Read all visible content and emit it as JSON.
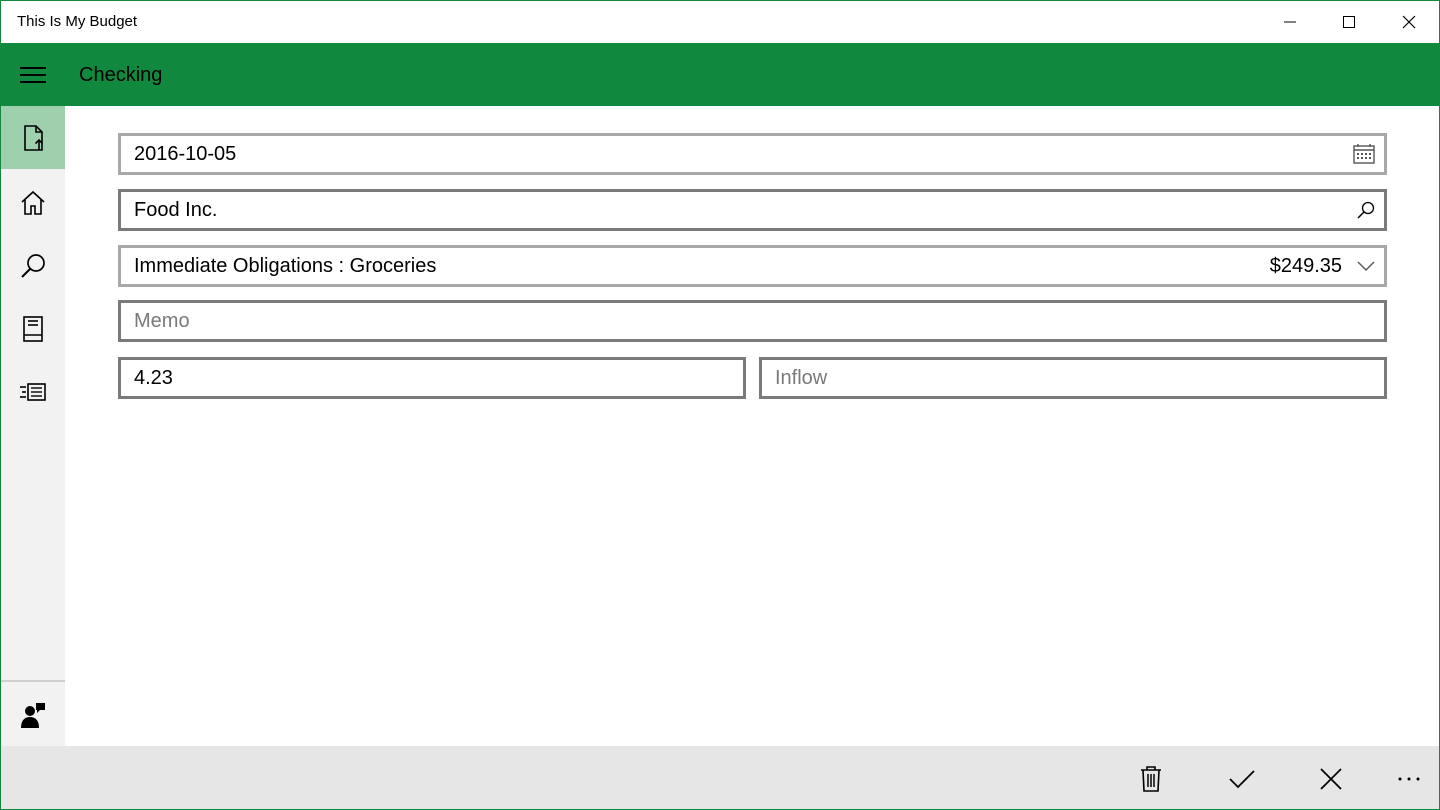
{
  "window": {
    "title": "This Is My Budget",
    "controls": [
      "minimize-icon",
      "maximize-icon",
      "close-icon"
    ]
  },
  "header": {
    "menu_icon": "hamburger-icon",
    "title": "Checking",
    "color": "#10893e"
  },
  "sidebar": {
    "items": [
      {
        "icon": "new-document-icon",
        "active": true
      },
      {
        "icon": "home-icon",
        "active": false
      },
      {
        "icon": "search-icon",
        "active": false
      },
      {
        "icon": "book-icon",
        "active": false
      },
      {
        "icon": "list-icon",
        "active": false
      }
    ],
    "footer_icon": "feedback-icon"
  },
  "form": {
    "date": {
      "value": "2016-10-05",
      "icon": "calendar-icon"
    },
    "payee": {
      "value": "Food Inc.",
      "icon": "search-icon"
    },
    "category": {
      "value": "Immediate Obligations : Groceries",
      "amount": "$249.35",
      "icon": "chevron-down-icon"
    },
    "memo": {
      "value": "",
      "placeholder": "Memo"
    },
    "outflow": {
      "value": "4.23"
    },
    "inflow": {
      "value": "",
      "placeholder": "Inflow"
    }
  },
  "commands": [
    "delete-icon",
    "accept-icon",
    "cancel-icon",
    "more-icon"
  ]
}
